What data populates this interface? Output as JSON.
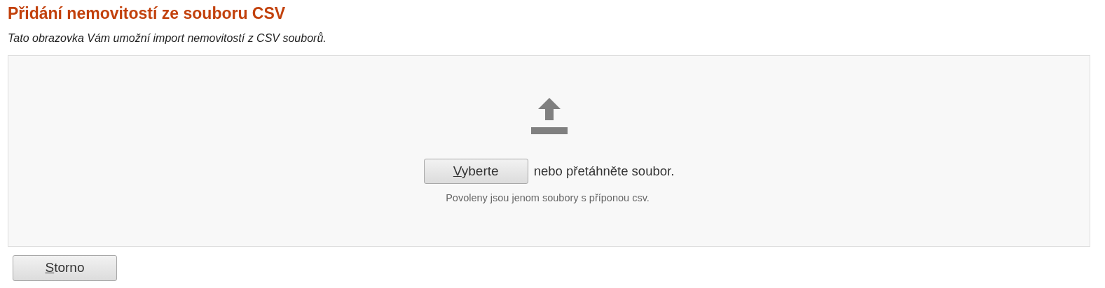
{
  "title": "Přidání nemovitostí ze souboru CSV",
  "subtitle": "Tato obrazovka Vám umožní import nemovitostí z CSV souborů.",
  "dropzone": {
    "button": {
      "label": "Vyberte",
      "accesskey_underlined": true
    },
    "text": "nebo přetáhněte soubor.",
    "hint": "Povoleny jsou jenom soubory s příponou csv."
  },
  "buttons": [
    {
      "label": "Storno",
      "accesskey_underlined": true
    }
  ]
}
